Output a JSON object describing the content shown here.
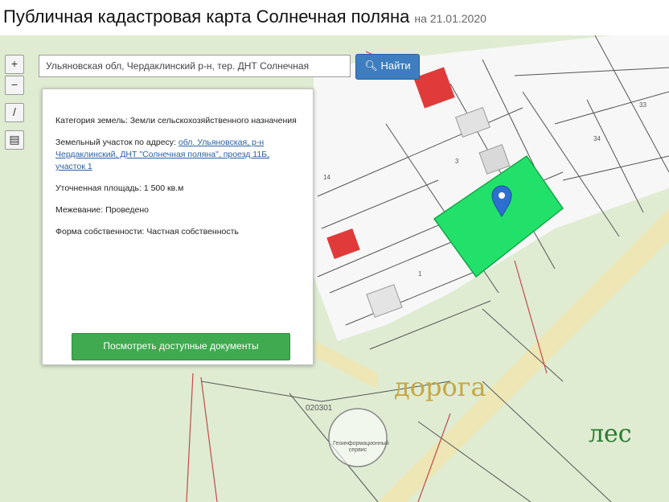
{
  "header": {
    "title": "Публичная кадастровая карта Солнечная поляна",
    "date": "на 21.01.2020"
  },
  "controls": {
    "zoom_in": "+",
    "zoom_out": "−",
    "measure": "/",
    "print": "▤"
  },
  "search": {
    "value": "Ульяновская обл, Чердаклинский р-н, тер. ДНТ Солнечная"
  },
  "find_button": {
    "label": "Найти"
  },
  "info_card": {
    "category_label": "Категория земель:",
    "category_value": "Земли сельскохозяйственного назначения",
    "address_label": "Земельный участок по адресу:",
    "address_value": "обл. Ульяновская, р-н Чердаклинский, ДНТ \"Солнечная поляна\", проезд 11Б, участок 1",
    "area_label": "Уточненная площадь:",
    "area_value": "1 500 кв.м",
    "survey_label": "Межевание:",
    "survey_value": "Проведено",
    "ownership_label": "Форма собственности:",
    "ownership_value": "Частная собственность",
    "docs_button": "Посмотреть доступные документы"
  },
  "map_labels": {
    "road": "дорога",
    "forest": "лес",
    "cadastral_number": "020301",
    "plot_14": "14",
    "plot_3": "3",
    "plot_34": "34",
    "plot_33": "33",
    "plot_1": "1",
    "watermark": "Геоинформационный сервис"
  },
  "colors": {
    "selected_plot": "#22e16a",
    "building": "#e03a3a",
    "road_strip": "#eee6b4",
    "forest": "#dfecd2",
    "marker": "#2d6fd1",
    "road_label": "#c9a640",
    "forest_label": "#2a7a30"
  }
}
